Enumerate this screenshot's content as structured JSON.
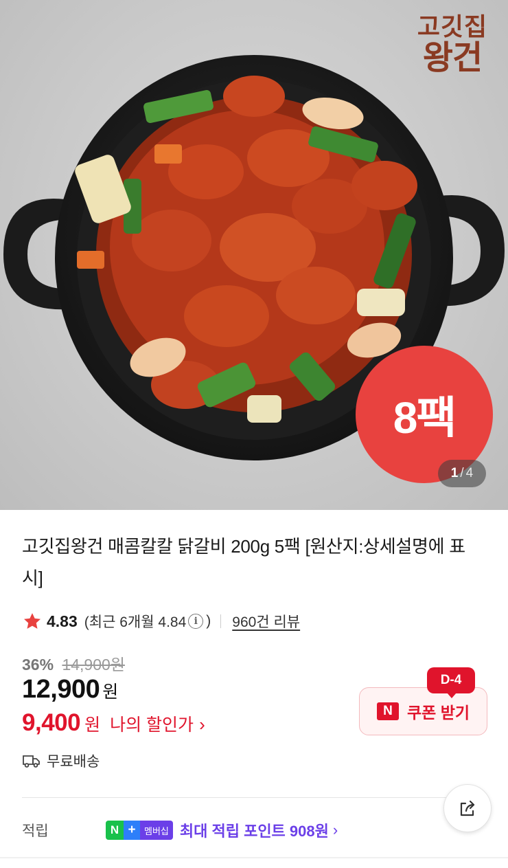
{
  "product_image": {
    "brand_logo_line1": "고깃집",
    "brand_logo_line2": "왕건",
    "pack_badge": "8팩",
    "pager_current": "1",
    "pager_separator": "/",
    "pager_total": "4"
  },
  "product": {
    "title": "고깃집왕건 매콤칼칼 닭갈비 200g 5팩 [원산지:상세설명에 표시]"
  },
  "rating": {
    "star_color": "#e8423f",
    "score": "4.83",
    "recent_prefix": "(최근 6개월 4.84",
    "recent_suffix": ")",
    "info_icon": "i",
    "reviews": "960건 리뷰"
  },
  "price": {
    "discount_rate": "36%",
    "original_price": "14,900원",
    "sale_price": "12,900",
    "sale_currency": "원",
    "my_price": "9,400",
    "my_currency": "원",
    "my_price_label": "나의 할인가",
    "my_price_chevron": "›"
  },
  "coupon": {
    "dday": "D-4",
    "brand_letter": "N",
    "label": "쿠폰 받기"
  },
  "delivery": {
    "label": "무료배송"
  },
  "points": {
    "label": "적립",
    "badge_n": "N",
    "badge_plus": "+",
    "badge_text": "멤버십",
    "text": "최대 적립 포인트 908원",
    "chevron": "›"
  },
  "colors": {
    "accent_red": "#e0142c",
    "membership_purple": "#6b3fe8",
    "naver_green": "#19c14b"
  }
}
